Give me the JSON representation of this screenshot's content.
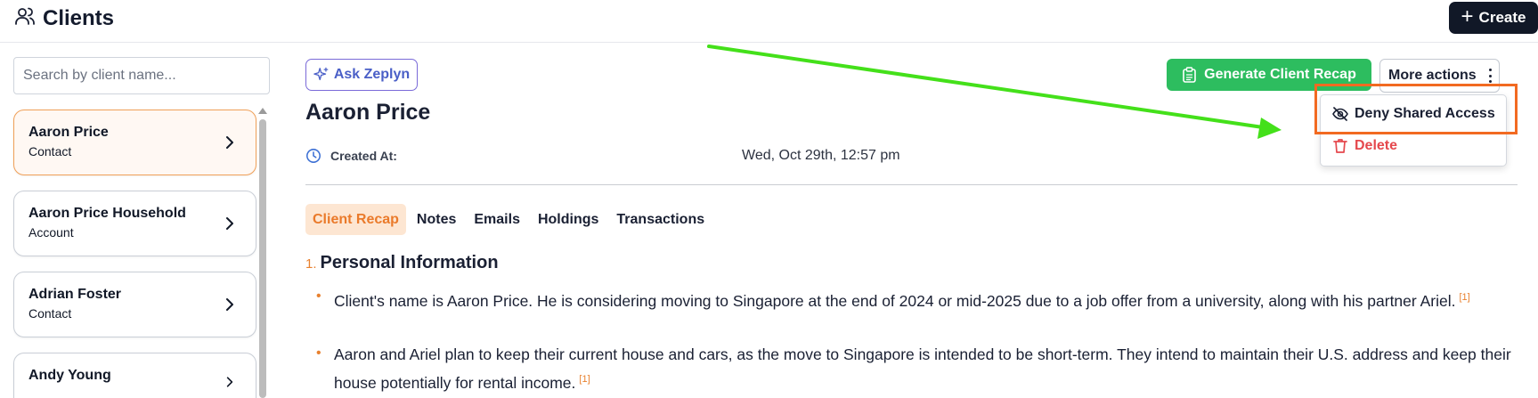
{
  "header": {
    "title": "Clients",
    "create_label": "Create"
  },
  "sidebar": {
    "search_placeholder": "Search by client name...",
    "clients": [
      {
        "name": "Aaron Price",
        "type": "Contact",
        "active": true
      },
      {
        "name": "Aaron Price Household",
        "type": "Account",
        "active": false
      },
      {
        "name": "Adrian Foster",
        "type": "Contact",
        "active": false
      },
      {
        "name": "Andy Young",
        "type": "",
        "active": false
      }
    ]
  },
  "main": {
    "ask_label": "Ask Zeplyn",
    "client_name": "Aaron Price",
    "created_label": "Created At:",
    "created_value": "Wed, Oct 29th, 12:57 pm",
    "generate_label": "Generate Client Recap",
    "more_actions_label": "More actions",
    "dropdown": {
      "deny_label": "Deny Shared Access",
      "delete_label": "Delete"
    },
    "tabs": [
      "Client Recap",
      "Notes",
      "Emails",
      "Holdings",
      "Transactions"
    ],
    "active_tab": "Client Recap",
    "section": {
      "number": "1.",
      "title": "Personal Information",
      "bullets": [
        {
          "text": "Client's name is Aaron Price. He is considering moving to Singapore at the end of 2024 or mid-2025 due to a job offer from a university, along with his partner Ariel.",
          "cite": "[1]"
        },
        {
          "text": "Aaron and Ariel plan to keep their current house and cars, as the move to Singapore is intended to be short-term. They intend to maintain their U.S. address and keep their house potentially for rental income.",
          "cite": "[1]"
        }
      ]
    }
  },
  "colors": {
    "accent_orange": "#ea7a2a",
    "brand_green": "#2dbd5f",
    "dark": "#111827",
    "danger": "#e5484d",
    "annotation_arrow": "#44e01a",
    "annotation_box": "#f26a21"
  },
  "icons": [
    "users-icon",
    "plus-icon",
    "sparkle-icon",
    "clipboard-icon",
    "more-vertical-icon",
    "eye-off-icon",
    "trash-icon",
    "clock-icon",
    "chevron-right-icon"
  ]
}
